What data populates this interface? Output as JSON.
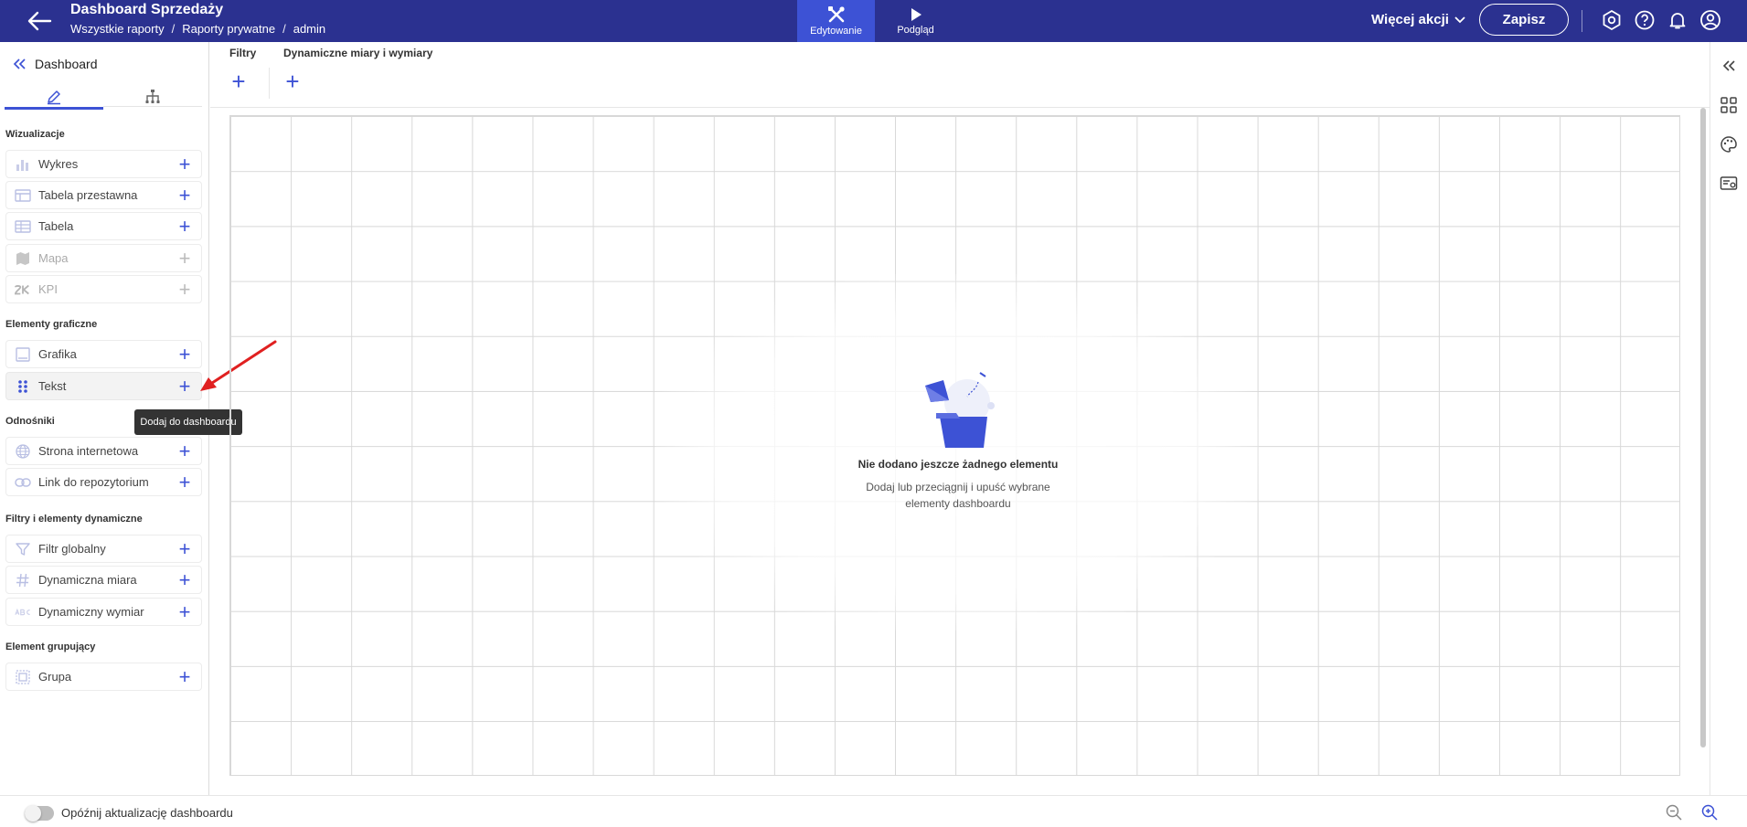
{
  "header": {
    "title": "Dashboard Sprzedaży",
    "breadcrumb": [
      "Wszystkie raporty",
      "Raporty prywatne",
      "admin"
    ],
    "breadcrumb_separator": "/",
    "mode_edit_label": "Edytowanie",
    "mode_preview_label": "Podgląd",
    "more_actions_label": "Więcej akcji",
    "save_label": "Zapisz",
    "colors": {
      "bar": "#2b3190",
      "active_mode": "#3d52d5"
    }
  },
  "left_panel": {
    "title": "Dashboard",
    "sections": [
      {
        "title": "Wizualizacje",
        "items": [
          {
            "label": "Wykres",
            "icon": "bar-chart-icon",
            "disabled": false
          },
          {
            "label": "Tabela przestawna",
            "icon": "pivot-table-icon",
            "disabled": false
          },
          {
            "label": "Tabela",
            "icon": "table-icon",
            "disabled": false
          },
          {
            "label": "Mapa",
            "icon": "map-icon",
            "disabled": true
          },
          {
            "label": "KPI",
            "icon": "kpi-icon",
            "disabled": true
          }
        ]
      },
      {
        "title": "Elementy graficzne",
        "items": [
          {
            "label": "Grafika",
            "icon": "image-icon",
            "disabled": false
          },
          {
            "label": "Tekst",
            "icon": "drag-handle-icon",
            "disabled": false
          }
        ]
      },
      {
        "title": "Odnośniki",
        "items": [
          {
            "label": "Strona internetowa",
            "icon": "globe-icon",
            "disabled": false
          },
          {
            "label": "Link do repozytorium",
            "icon": "link-icon",
            "disabled": false
          }
        ]
      },
      {
        "title": "Filtry i elementy dynamiczne",
        "items": [
          {
            "label": "Filtr globalny",
            "icon": "filter-icon",
            "disabled": false
          },
          {
            "label": "Dynamiczna miara",
            "icon": "hash-icon",
            "disabled": false
          },
          {
            "label": "Dynamiczny wymiar",
            "icon": "abc-icon",
            "disabled": false
          }
        ]
      },
      {
        "title": "Element grupujący",
        "items": [
          {
            "label": "Grupa",
            "icon": "group-icon",
            "disabled": false
          }
        ]
      }
    ],
    "tooltip": "Dodaj do dashboardu"
  },
  "filters_bar": {
    "filters_label": "Filtry",
    "dynamic_label": "Dynamiczne miary i wymiary"
  },
  "canvas": {
    "empty_title": "Nie dodano jeszcze żadnego elementu",
    "empty_description": "Dodaj lub przeciągnij i upuść wybrane elementy dashboardu"
  },
  "bottom_bar": {
    "delay_toggle_label": "Opóźnij aktualizację dashboardu",
    "delay_toggle_on": false
  }
}
